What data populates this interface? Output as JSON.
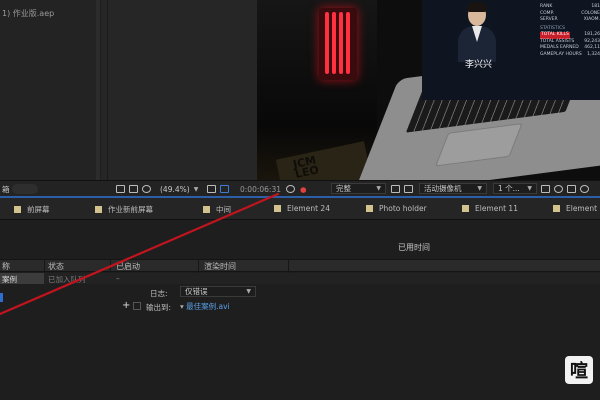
{
  "project": {
    "file_name": "1) 作业版.aep"
  },
  "viewer": {
    "monitor_name": "李兴兴",
    "stats": {
      "rank_label": "RANK",
      "rank_value": "181",
      "company_label": "COMP.",
      "company_value": "COLONE",
      "server_label": "SERVER",
      "server_value": "XIAOM.",
      "section": "STATISTICS",
      "total_kills_label": "TOTAL KILLS",
      "total_kills_value": "181,26",
      "total_assists_label": "TOTAL ASSISTS",
      "total_assists_value": "92,243",
      "medals_label": "MEDALS EARNED",
      "medals_value": "462,11",
      "hours_label": "GAMEPLAY HOURS",
      "hours_value": "1,324"
    },
    "box_text": "JCM\nLEO"
  },
  "viewer_bar": {
    "panel_label": "箱",
    "zoom": "(49.4%)",
    "timecode": "0:00:06:31",
    "resolution": "完整",
    "camera": "活动摄像机",
    "views": "1 个..."
  },
  "comp_tabs": [
    {
      "label": "前屏幕"
    },
    {
      "label": "作业新前屏幕"
    },
    {
      "label": "中间"
    },
    {
      "label": "Element 24"
    },
    {
      "label": "Photo holder"
    },
    {
      "label": "Element 11"
    },
    {
      "label": "Element"
    }
  ],
  "render_queue": {
    "elapsed_label": "已用时间",
    "columns": [
      "称",
      "状态",
      "已启动",
      "渲染时间"
    ],
    "item": {
      "name": "案例",
      "status": "已加入队列",
      "started": "–"
    },
    "log_label": "日志:",
    "log_value": "仅错误",
    "output_label": "输出到:",
    "output_value": "最佳案例.avi",
    "add_symbol": "+"
  },
  "watermark": {
    "glyph": "喧"
  },
  "annotation": {
    "color": "#c0141e"
  }
}
